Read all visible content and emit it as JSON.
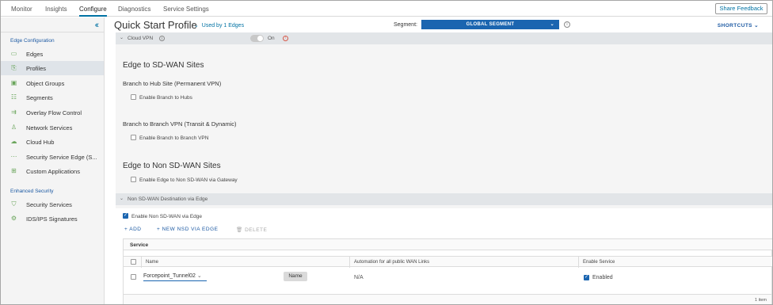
{
  "topnav": {
    "tabs": [
      {
        "label": "Monitor"
      },
      {
        "label": "Insights"
      },
      {
        "label": "Configure"
      },
      {
        "label": "Diagnostics"
      },
      {
        "label": "Service Settings"
      }
    ],
    "active_tab": "Configure",
    "share_feedback": "Share Feedback"
  },
  "sidebar": {
    "collapse_icon": "double-chevron-left-icon",
    "sections": [
      {
        "label": "Edge Configuration",
        "items": [
          {
            "label": "Edges",
            "icon": "edge-icon"
          },
          {
            "label": "Profiles",
            "icon": "profiles-icon",
            "active": true
          },
          {
            "label": "Object Groups",
            "icon": "object-groups-icon"
          },
          {
            "label": "Segments",
            "icon": "segments-icon"
          },
          {
            "label": "Overlay Flow Control",
            "icon": "overlay-flow-icon"
          },
          {
            "label": "Network Services",
            "icon": "network-services-icon"
          },
          {
            "label": "Cloud Hub",
            "icon": "cloud-hub-icon"
          },
          {
            "label": "Security Service Edge (S...",
            "icon": "security-service-edge-icon"
          },
          {
            "label": "Custom Applications",
            "icon": "custom-applications-icon"
          }
        ]
      },
      {
        "label": "Enhanced Security",
        "items": [
          {
            "label": "Security Services",
            "icon": "shield-icon"
          },
          {
            "label": "IDS/IPS Signatures",
            "icon": "signatures-icon"
          }
        ]
      }
    ]
  },
  "header": {
    "title": "Quick Start Profile",
    "used_by": "Used by 1 Edges",
    "segment_label": "Segment:",
    "segment_value": "GLOBAL SEGMENT",
    "shortcuts": "SHORTCUTS"
  },
  "cloud_vpn": {
    "bar_label": "Cloud VPN",
    "toggle_label": "On",
    "toggle_on": true
  },
  "edge_to_sdwan": {
    "heading": "Edge to SD-WAN Sites",
    "branch_to_hub": {
      "heading": "Branch to Hub Site (Permanent VPN)",
      "checkbox_label": "Enable Branch to Hubs",
      "checked": false
    },
    "branch_to_branch": {
      "heading": "Branch to Branch VPN (Transit & Dynamic)",
      "checkbox_label": "Enable Branch to Branch VPN",
      "checked": false
    }
  },
  "edge_to_non_sdwan": {
    "heading": "Edge to Non SD-WAN Sites",
    "checkbox_label": "Enable Edge to Non SD-WAN via Gateway",
    "checked": false
  },
  "nsd_section": {
    "bar_label": "Non SD-WAN Destination via Edge",
    "checkbox_label": "Enable Non SD-WAN via Edge",
    "checked": true,
    "actions": {
      "add": "ADD",
      "new_nsd": "NEW NSD VIA EDGE",
      "delete": "DELETE"
    },
    "table": {
      "caption": "Service",
      "columns": [
        "Name",
        "Automation for all public WAN Links",
        "Enable Service"
      ],
      "rows": [
        {
          "name": "Forcepoint_Tunnel02",
          "automation": "N/A",
          "enable_label": "Enabled",
          "enabled": true
        }
      ],
      "tooltip": "Name",
      "footer": "1 item"
    }
  }
}
